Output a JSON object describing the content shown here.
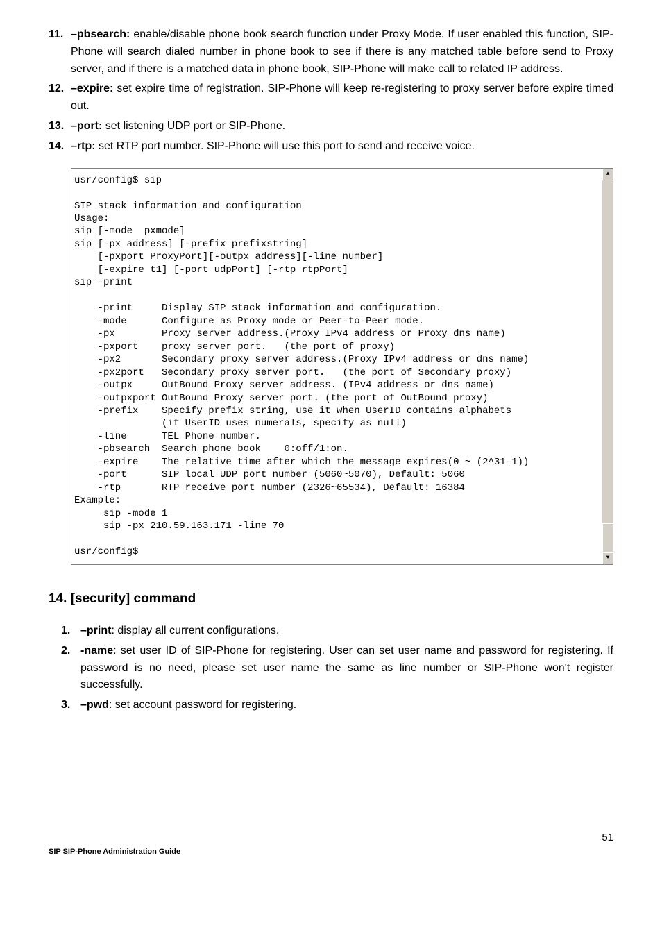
{
  "list1": [
    {
      "num": "11.",
      "lead": "–pbsearch:",
      "text": " enable/disable phone book search function under Proxy Mode. If user enabled this function, SIP-Phone will search dialed number in phone book to see if there is any matched table before send to Proxy server, and if there is a matched data in phone book, SIP-Phone will make call to related IP address."
    },
    {
      "num": "12.",
      "lead": "–expire:",
      "text": " set expire time of registration. SIP-Phone will keep re-registering to proxy server before expire timed out."
    },
    {
      "num": "13.",
      "lead": "–port:",
      "text": " set listening UDP port or SIP-Phone."
    },
    {
      "num": "14.",
      "lead": "–rtp:",
      "text": " set RTP port number. SIP-Phone will use this port to send and receive voice."
    }
  ],
  "terminal": "usr/config$ sip\n\nSIP stack information and configuration\nUsage:\nsip [-mode  pxmode]\nsip [-px address] [-prefix prefixstring]\n    [-pxport ProxyPort][-outpx address][-line number]\n    [-expire t1] [-port udpPort] [-rtp rtpPort]\nsip -print\n\n    -print     Display SIP stack information and configuration.\n    -mode      Configure as Proxy mode or Peer-to-Peer mode.\n    -px        Proxy server address.(Proxy IPv4 address or Proxy dns name)\n    -pxport    proxy server port.   (the port of proxy)\n    -px2       Secondary proxy server address.(Proxy IPv4 address or dns name)\n    -px2port   Secondary proxy server port.   (the port of Secondary proxy)\n    -outpx     OutBound Proxy server address. (IPv4 address or dns name)\n    -outpxport OutBound Proxy server port. (the port of OutBound proxy)\n    -prefix    Specify prefix string, use it when UserID contains alphabets\n               (if UserID uses numerals, specify as null)\n    -line      TEL Phone number.\n    -pbsearch  Search phone book    0:off/1:on.\n    -expire    The relative time after which the message expires(0 ~ (2^31-1))\n    -port      SIP local UDP port number (5060~5070), Default: 5060\n    -rtp       RTP receive port number (2326~65534), Default: 16384\nExample:\n     sip -mode 1\n     sip -px 210.59.163.171 -line 70\n\nusr/config$",
  "section2_title": "14. [security] command",
  "list2": [
    {
      "num": "1.",
      "lead": "–print",
      "text": ": display all current configurations."
    },
    {
      "num": "2.",
      "lead": "-name",
      "text": ": set user ID of SIP-Phone for registering. User can set user name and password for registering. If password is no need, please set user name the same as line number or SIP-Phone won't register successfully."
    },
    {
      "num": "3.",
      "lead": "–pwd",
      "text": ": set account password for registering."
    }
  ],
  "page_num": "51",
  "footer": "SIP SIP-Phone   Administration Guide",
  "icons": {
    "up": "▲",
    "down": "▼"
  }
}
